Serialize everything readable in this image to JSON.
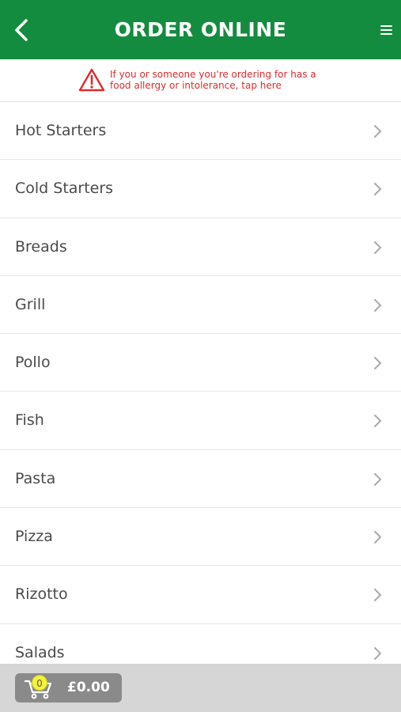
{
  "header": {
    "title": "ORDER ONLINE",
    "back_icon": "chevron-left-icon",
    "menu_icon": "hamburger-menu-icon",
    "background_color": "#148c3f"
  },
  "allergy_notice": {
    "line1": "If you or someone you're ordering for has a",
    "line2": "food allergy or intolerance, tap here",
    "icon": "warning-icon",
    "color": "#e02a2a"
  },
  "categories": [
    {
      "label": "Hot Starters"
    },
    {
      "label": "Cold Starters"
    },
    {
      "label": "Breads"
    },
    {
      "label": "Grill"
    },
    {
      "label": "Pollo"
    },
    {
      "label": "Fish"
    },
    {
      "label": "Pasta"
    },
    {
      "label": "Pizza"
    },
    {
      "label": "Rizotto"
    },
    {
      "label": "Salads"
    }
  ],
  "cart": {
    "count": "0",
    "total": "£0.00",
    "icon": "shopping-cart-icon"
  }
}
